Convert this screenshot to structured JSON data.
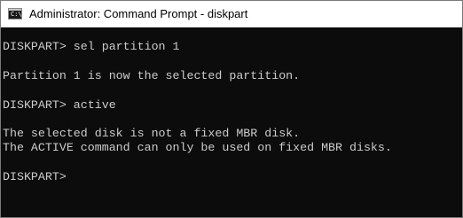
{
  "window": {
    "title": "Administrator: Command Prompt - diskpart",
    "app_icon": "cmd-icon",
    "app_icon_glyph": "C:\\"
  },
  "console": {
    "lines": [
      "DISKPART> sel partition 1",
      "",
      "Partition 1 is now the selected partition.",
      "",
      "DISKPART> active",
      "",
      "The selected disk is not a fixed MBR disk.",
      "The ACTIVE command can only be used on fixed MBR disks.",
      "",
      "DISKPART> "
    ],
    "text_color": "#cccccc",
    "background_color": "#0c0c0c"
  }
}
